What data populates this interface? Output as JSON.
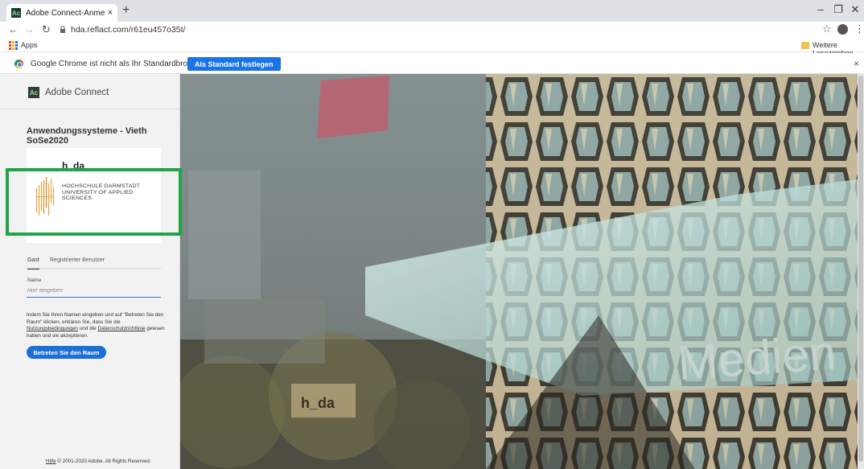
{
  "browser": {
    "tab_title": "Adobe Connect-Anmeldung",
    "tab_close": "×",
    "new_tab": "+",
    "url": "hda.reflact.com/r61eu457o35t/",
    "window_controls": [
      "–",
      "❐",
      "✕"
    ],
    "bookmarks": {
      "apps_label": "Apps",
      "other_label": "Weitere Lesezeichen"
    },
    "infobar": {
      "text": "Google Chrome ist nicht als Ihr Standardbrowser festgelegt",
      "button": "Als Standard festlegen",
      "close": "×"
    }
  },
  "panel": {
    "brand": "Adobe Connect",
    "brand_icon_text": "Ac",
    "meeting_title": "Anwendungssysteme - Vieth SoSe2020",
    "logo": {
      "name": "h_da",
      "line1": "HOCHSCHULE DARMSTADT",
      "line2": "UNIVERSITY OF APPLIED SCIENCES"
    },
    "tabs": {
      "guest": "Gast",
      "registered": "Registrierter Benutzer"
    },
    "name_label": "Name",
    "name_placeholder": "Hier eingeben",
    "terms": {
      "part1": "Indem Sie Ihren Namen eingeben und auf \"Betreten Sie den Raum\" klicken, erklären Sie, dass Sie die",
      "link1": "Nutzungsbedingungen",
      "part2": "und die",
      "link2": "Datenschutzrichtlinie",
      "part3": "gelesen haben und sie akzeptieren."
    },
    "join_button": "Betreten Sie den Raum",
    "footer": {
      "help": "Hilfe",
      "copyright": "© 2001-2020 Adobe. All Rights Reserved."
    }
  },
  "background": {
    "sign_text": "h_da",
    "wall_text": "Medien"
  },
  "colors": {
    "accent": "#1a73e8",
    "join": "#1d6fd6",
    "highlight": "#1ea646"
  }
}
